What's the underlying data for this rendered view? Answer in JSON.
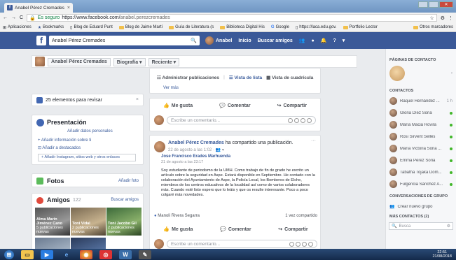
{
  "browser": {
    "tab_title": "Anabel Pérez Cremades",
    "tab_close": "×",
    "secure_label": "Es seguro",
    "url_prefix": "https://www.facebook.com/",
    "url_path": "anabel.perezcremades",
    "bookmarks": [
      "Aplicaciones",
      "Bookmarks",
      "Blog de Eduard Punt",
      "Blog de Jaime Martí",
      "Guía de Literatura (s",
      "Biblioteca Digital His",
      "Google",
      "https://laca.edu.gov.",
      "Portfolio Lector",
      "Otros marcadores"
    ]
  },
  "fb": {
    "logo": "f",
    "search_value": "Anabel Pérez Cremades",
    "nav_name": "Anabel",
    "nav_home": "Inicio",
    "nav_find": "Buscar amigos"
  },
  "profile": {
    "name": "Anabel Pérez Cremades",
    "biography": "Biografía ▾",
    "recent": "Reciente ▾"
  },
  "left": {
    "review_text": "25 elementos para revisar",
    "presentation_title": "Presentación",
    "add_personal": "Añadir datos personales",
    "add_info": "Añadir información sobre ti",
    "add_featured": "Añadir a destacados",
    "add_instagram": "Añadir Instagram, sitios web y otros enlaces",
    "photos_title": "Fotos",
    "add_photo": "Añadir foto",
    "friends_title": "Amigos",
    "friends_count": "122",
    "find_friends": "Buscar amigos",
    "friend_tiles": [
      {
        "name": "Alma Marín Jiménez Cano",
        "sub": "5 publicaciones nuevas"
      },
      {
        "name": "Toni Vidal",
        "sub": "2 publicaciones nuevas"
      },
      {
        "name": "Toni Jacobo Gil",
        "sub": "2 publicaciones nuevas"
      }
    ]
  },
  "center": {
    "admin_posts": "Administrar publicaciones",
    "list_view": "Vista de lista",
    "grid_view": "Vista de cuadrícula",
    "see_more": "Ver más",
    "like": "Me gusta",
    "comment": "Comentar",
    "share": "Compartir",
    "write_comment": "Escribe un comentario...",
    "post2_author": "Anabel Pérez Cremades",
    "post2_action": "ha compartido una publicación.",
    "post2_date": "22 de agosto a las 1:02 · 👥 ▾",
    "shared_author": "Jose Francisco Erades Marhuenda",
    "shared_date": "21 de agosto a las 23:17",
    "shared_text": "Soy estudiante de periodismo de la UMH. Como trabajo de fin de grado he escrito un artículo sobre la seguridad en Aspe. Estará disponible en Septiembre. He contado con la colaboración del Ayuntamiento de Aspe, la Policía Local, los Bomberos de Elche, miembros de los centros educativos de la localidad así como de varios colaboradores más. Cuando esté listo espero que lo leáis y que os resulte interesante. Poco a poco colgaré más novedades.",
    "liked_by": "Manoli Rivera Segarra",
    "shared_count": "1 vez compartido"
  },
  "chat": {
    "pages_header": "PÁGINAS DE CONTACTO",
    "contacts_header": "CONTACTOS",
    "contacts": [
      {
        "name": "Raquel Hernández ...",
        "extra": "1 h"
      },
      {
        "name": "Gloria Díez Soria",
        "extra": ""
      },
      {
        "name": "María Maciá Rovira",
        "extra": ""
      },
      {
        "name": "Rosi Sirvent Sellés",
        "extra": ""
      },
      {
        "name": "María Victoria Soria ...",
        "extra": ""
      },
      {
        "name": "Emma Pérez Soria",
        "extra": ""
      },
      {
        "name": "Tabatha Tojaka Dom...",
        "extra": ""
      },
      {
        "name": "Fulgencia Sánchez A...",
        "extra": ""
      }
    ],
    "group_header": "CONVERSACIONES DE GRUPO",
    "create_group": "Crear nuevo grupo",
    "more_header": "MÁS CONTACTOS (2)",
    "search_placeholder": "Busca"
  },
  "taskbar": {
    "time": "22:51",
    "date": "21/08/2018"
  }
}
